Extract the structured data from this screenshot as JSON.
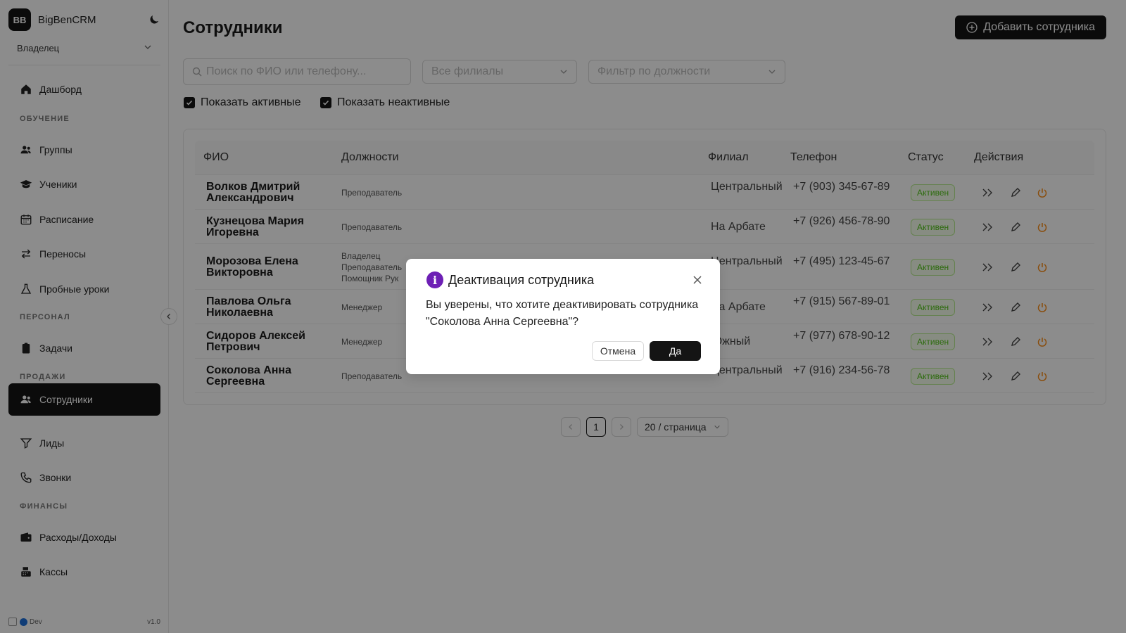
{
  "brand": {
    "logo_text": "BB",
    "name": "BigBenCRM"
  },
  "role_select": {
    "value": "Владелец"
  },
  "sidebar": {
    "items": [
      {
        "label": "Дашборд",
        "icon": "home-icon"
      },
      {
        "section": "ОБУЧЕНИЕ"
      },
      {
        "label": "Группы",
        "icon": "users-icon"
      },
      {
        "label": "Ученики",
        "icon": "graduation-cap-icon"
      },
      {
        "label": "Расписание",
        "icon": "calendar-icon"
      },
      {
        "label": "Переносы",
        "icon": "swap-icon"
      },
      {
        "label": "Пробные уроки",
        "icon": "flask-icon"
      },
      {
        "section": "ПЕРСОНАЛ"
      },
      {
        "label": "Задачи",
        "icon": "clipboard-icon"
      },
      {
        "section": "ПРОДАЖИ"
      },
      {
        "label": "Сотрудники",
        "icon": "users-icon",
        "active": true
      },
      {
        "label": "Лиды",
        "icon": "filter-icon"
      },
      {
        "label": "Звонки",
        "icon": "phone-icon"
      },
      {
        "section": "ФИНАНСЫ"
      },
      {
        "label": "Расходы/Доходы",
        "icon": "wallet-icon"
      },
      {
        "label": "Кассы",
        "icon": "cash-register-icon"
      }
    ],
    "footer": {
      "env": "Dev",
      "version": "v1.0"
    }
  },
  "header": {
    "title": "Сотрудники",
    "add_button": "Добавить сотрудника"
  },
  "filters": {
    "search_placeholder": "Поиск по ФИО или телефону...",
    "branch_placeholder": "Все филиалы",
    "position_placeholder": "Фильтр по должности",
    "show_active": "Показать активные",
    "show_inactive": "Показать неактивные"
  },
  "table": {
    "columns": [
      "ФИО",
      "Должности",
      "Филиал",
      "Телефон",
      "Статус",
      "Действия"
    ],
    "rows": [
      {
        "fio": "Волков Дмитрий Александрович",
        "roles": [
          "Преподаватель"
        ],
        "branch": "Центральный",
        "phone": "+7 (903) 345-67-89",
        "status": "Активен"
      },
      {
        "fio": "Кузнецова Мария Игоревна",
        "roles": [
          "Преподаватель"
        ],
        "branch": "На Арбате",
        "phone": "+7 (926) 456-78-90",
        "status": "Активен"
      },
      {
        "fio": "Морозова Елена Викторовна",
        "roles": [
          "Владелец",
          "Преподаватель",
          "Помощник Рук"
        ],
        "branch": "Центральный",
        "phone": "+7 (495) 123-45-67",
        "status": "Активен"
      },
      {
        "fio": "Павлова Ольга Николаевна",
        "roles": [
          "Менеджер"
        ],
        "branch": "На Арбате",
        "phone": "+7 (915) 567-89-01",
        "status": "Активен"
      },
      {
        "fio": "Сидоров Алексей Петрович",
        "roles": [
          "Менеджер"
        ],
        "branch": "Южный",
        "phone": "+7 (977) 678-90-12",
        "status": "Активен"
      },
      {
        "fio": "Соколова Анна Сергеевна",
        "roles": [
          "Преподаватель"
        ],
        "branch": "Центральный",
        "phone": "+7 (916) 234-56-78",
        "status": "Активен"
      }
    ]
  },
  "pagination": {
    "current": "1",
    "page_size": "20 / страница"
  },
  "modal": {
    "title": "Деактивация сотрудника",
    "text": "Вы уверены, что хотите деактивировать сотрудника \"Соколова Анна Сергеевна\"?",
    "cancel": "Отмена",
    "ok": "Да"
  },
  "colors": {
    "primary": "#141414",
    "status_green": "#52c41a",
    "power_orange": "#fa8c16",
    "modal_icon": "#6d1fb5"
  }
}
